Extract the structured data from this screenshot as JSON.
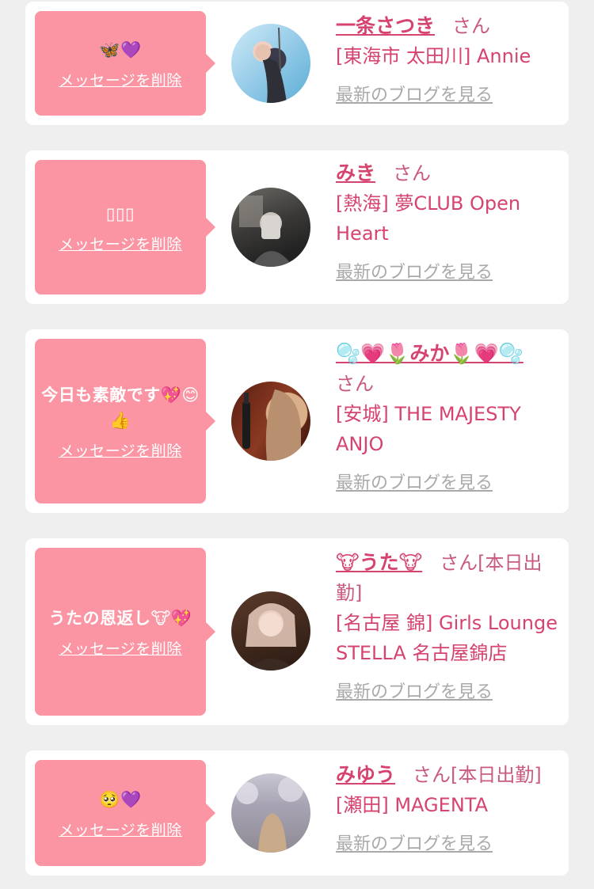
{
  "cards": [
    {
      "message": "🦋💜",
      "delete_label": "メッセージを削除",
      "name": "一条さつき",
      "honorific": "さん",
      "shop": "[東海市 太田川] Annie",
      "blog_link": "最新のブログを見る"
    },
    {
      "message": "▯▯▯",
      "delete_label": "メッセージを削除",
      "name": "みき",
      "honorific": "さん",
      "shop": "[熱海] 夢CLUB Open Heart",
      "blog_link": "最新のブログを見る"
    },
    {
      "message": "今日も素敵です💖😊👍",
      "delete_label": "メッセージを削除",
      "name": "🫧💗🌷みか🌷💗🫧",
      "honorific": "さん",
      "shop": "[安城] THE MAJESTY ANJO",
      "blog_link": "最新のブログを見る"
    },
    {
      "message": "うたの恩返し🐮💖",
      "delete_label": "メッセージを削除",
      "name": "🐮うた🐮",
      "honorific": "さん[本日出勤]",
      "shop": "[名古屋 錦] Girls Lounge STELLA 名古屋錦店",
      "blog_link": "最新のブログを見る"
    },
    {
      "message": "🥺💜",
      "delete_label": "メッセージを削除",
      "name": "みゆう",
      "honorific": "さん[本日出勤]",
      "shop": "[瀬田] MAGENTA",
      "blog_link": "最新のブログを見る"
    }
  ],
  "colors": {
    "bubble": "#fb95a3",
    "accent": "#d6436e",
    "link_gray": "#a9a9a9",
    "page_bg": "#efefef"
  }
}
